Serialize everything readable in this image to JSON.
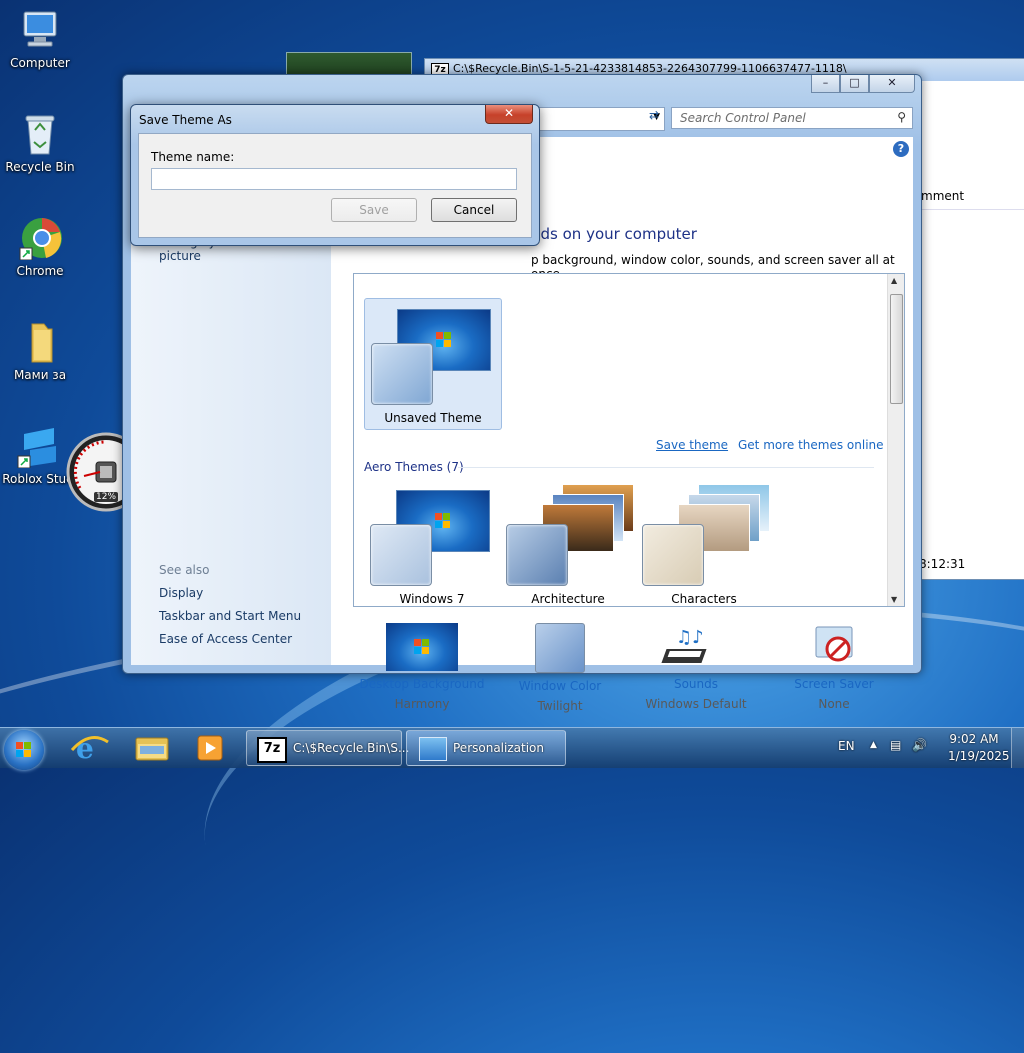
{
  "desktop": {
    "icons": [
      {
        "label": "Computer"
      },
      {
        "label": "Recycle Bin"
      },
      {
        "label": "Chrome"
      },
      {
        "label": "Мами за"
      },
      {
        "label": "Roblox Stud"
      }
    ],
    "gadget": {
      "percent": "12%"
    }
  },
  "background_window": {
    "title": "C:\\$Recycle.Bin\\S-1-5-21-4233814853-2264307799-1106637477-1118\\",
    "column": "mment",
    "time": "8:12:31"
  },
  "personalization": {
    "search_placeholder": "Search Control Panel",
    "heading": "nds on your computer",
    "subheading": "p background, window color, sounds, and screen saver all at once.",
    "sidebar_link": "Change your account picture",
    "see_also": "See also",
    "see_also_links": [
      "Display",
      "Taskbar and Start Menu",
      "Ease of Access Center"
    ],
    "unsaved_theme": "Unsaved Theme",
    "save_theme": "Save theme",
    "get_more": "Get more themes online",
    "aero_title": "Aero Themes (7)",
    "aero_themes": [
      "Windows 7",
      "Architecture",
      "Characters"
    ],
    "bottom": [
      {
        "label": "Desktop Background",
        "value": "Harmony"
      },
      {
        "label": "Window Color",
        "value": "Twilight"
      },
      {
        "label": "Sounds",
        "value": "Windows Default"
      },
      {
        "label": "Screen Saver",
        "value": "None"
      }
    ]
  },
  "dialog": {
    "title": "Save Theme As",
    "field_label": "Theme name:",
    "field_value": "",
    "save": "Save",
    "cancel": "Cancel"
  },
  "taskbar": {
    "buttons": [
      {
        "label": "C:\\$Recycle.Bin\\S..."
      },
      {
        "label": "Personalization"
      }
    ],
    "lang": "EN",
    "time": "9:02 AM",
    "date": "1/19/2025"
  },
  "colors": {
    "accent": "#1a67c2",
    "heading": "#1e3287"
  }
}
